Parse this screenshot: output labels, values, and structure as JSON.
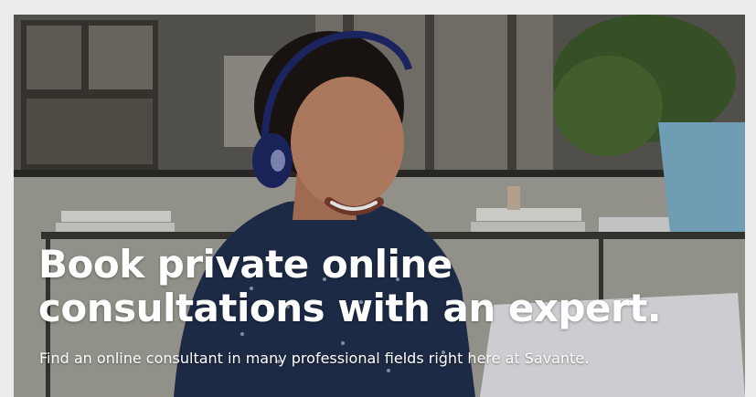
{
  "hero": {
    "headline": "Book private online consultations with an expert.",
    "subtext": "Find an online consultant in many professional fields right here at Savante.",
    "image": "woman-with-headphones-smiling-at-laptop",
    "colors": {
      "text": "#ffffff",
      "background_dark": "#4b4843",
      "plant_pot": "#7fb3cc"
    }
  }
}
